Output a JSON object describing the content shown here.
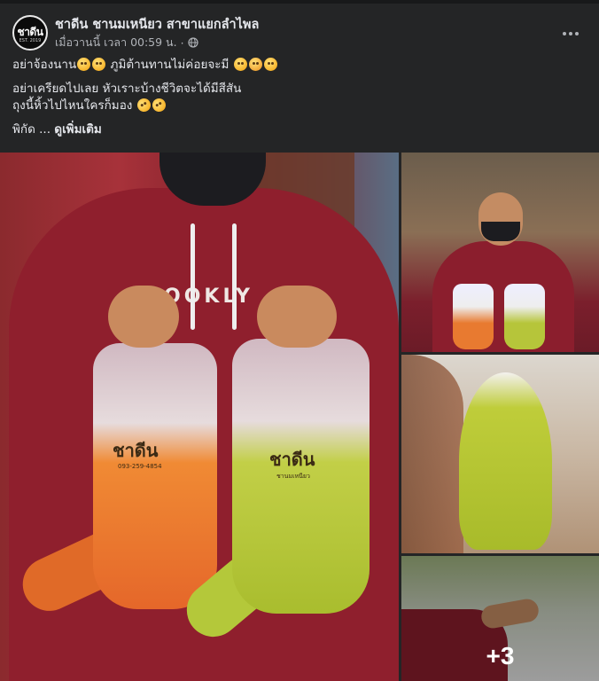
{
  "post": {
    "page_name": "ชาดีน ชานมเหนียว สาขาแยกลำไพล",
    "timestamp": "เมื่อวานนี้ เวลา 00:59 น.",
    "separator": "·",
    "privacy_icon": "globe-icon",
    "more_icon": "more-horizontal-icon",
    "avatar": {
      "logo_text": "ชาดีน",
      "logo_sub": "EST. 2019"
    },
    "text_lines": {
      "line1": "อย่าจ้องนาน",
      "line1b": " ภูมิต้านทานไม่ค่อยจะมี ",
      "line2": "อย่าเครียดไปเลย หัวเราะบ้างชีวิตจะได้มีสีสัน",
      "line3": "ถุงนี้หิ้วไปไหนใครก็มอง ",
      "line4_prefix": "พิกัด ... ",
      "see_more": "ดูเพิ่มเติม"
    }
  },
  "gallery": {
    "main": {
      "hoodie_print": "OOKLY",
      "bag_orange_label": "ชาดีน",
      "bag_orange_sub": "093-259-4854",
      "bag_green_label": "ชาดีน",
      "bag_green_sub": "ชานมเหนียว"
    },
    "more_count": "+3"
  },
  "colors": {
    "background": "#242526",
    "text_primary": "#e4e6eb",
    "text_secondary": "#b0b3b8",
    "bag_orange": "#e5672a",
    "bag_green": "#a9bd2e",
    "hoodie": "#8f1f2d"
  }
}
